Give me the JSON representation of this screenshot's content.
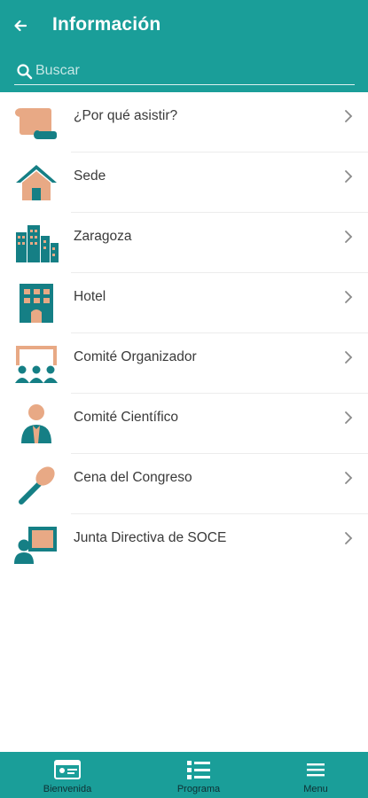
{
  "header": {
    "title": "Información",
    "back_icon": "arrow-left-icon"
  },
  "search": {
    "placeholder": "Buscar",
    "value": "",
    "icon": "search-icon"
  },
  "colors": {
    "primary": "#1a9e99",
    "accent_peach": "#e8a985",
    "icon_teal": "#157f85",
    "text": "#3a3a3a"
  },
  "items": [
    {
      "label": "¿Por qué asistir?",
      "icon": "scroll-icon"
    },
    {
      "label": "Sede",
      "icon": "house-icon"
    },
    {
      "label": "Zaragoza",
      "icon": "city-icon"
    },
    {
      "label": "Hotel",
      "icon": "hotel-icon"
    },
    {
      "label": "Comité Organizador",
      "icon": "audience-icon"
    },
    {
      "label": "Comité Científico",
      "icon": "person-icon"
    },
    {
      "label": "Cena del Congreso",
      "icon": "spoon-icon"
    },
    {
      "label": "Junta Directiva de SOCE",
      "icon": "presenter-icon"
    }
  ],
  "bottom_nav": [
    {
      "label": "Bienvenida",
      "icon": "id-card-icon"
    },
    {
      "label": "Programa",
      "icon": "list-icon"
    },
    {
      "label": "Menu",
      "icon": "hamburger-menu-icon"
    }
  ]
}
